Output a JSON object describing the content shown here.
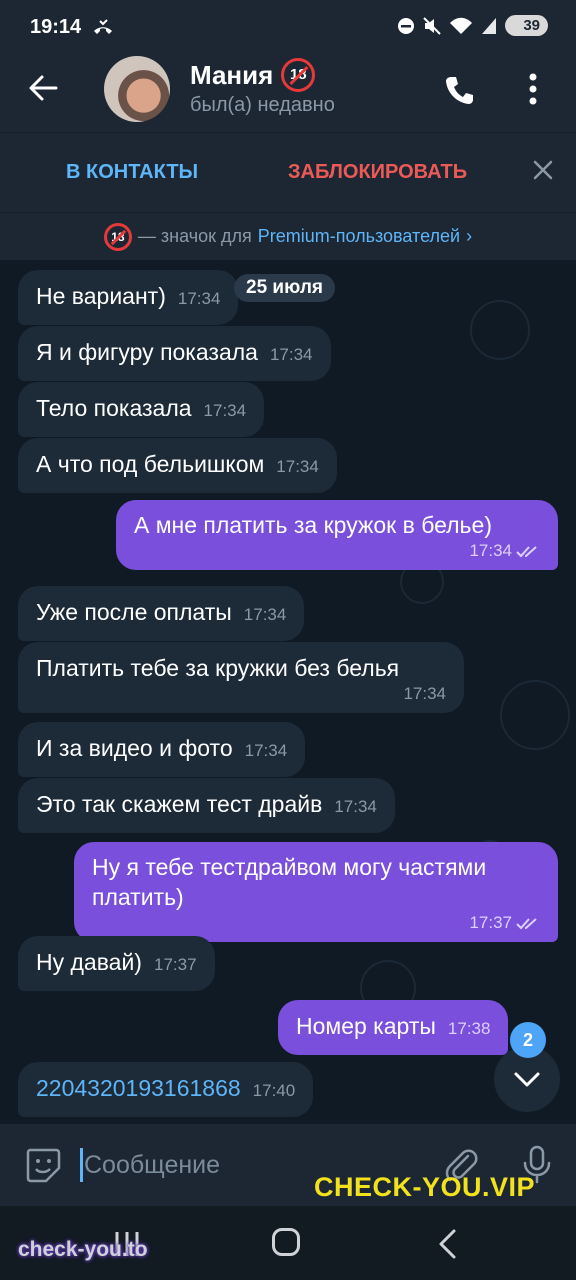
{
  "status_bar": {
    "time": "19:14",
    "battery": "39"
  },
  "header": {
    "contact_name": "Мания",
    "last_seen": "был(а) недавно",
    "avatar_badge": "18"
  },
  "actions": {
    "add_contact": "В КОНТАКТЫ",
    "block": "ЗАБЛОКИРОВАТЬ"
  },
  "premium_notice": {
    "prefix": "— значок для",
    "link": "Premium-пользователей",
    "arrow": "›"
  },
  "date_pill": "25 июля",
  "messages": [
    {
      "dir": "in",
      "text": "Не вариант)",
      "time": "17:34"
    },
    {
      "dir": "in",
      "text": "Я и фигуру показала",
      "time": "17:34"
    },
    {
      "dir": "in",
      "text": "Тело показала",
      "time": "17:34"
    },
    {
      "dir": "in",
      "text": "А что под бельишком",
      "time": "17:34"
    },
    {
      "dir": "out",
      "text": "А мне платить за кружок в белье)",
      "time": "17:34"
    },
    {
      "dir": "in",
      "text": "Уже после оплаты",
      "time": "17:34"
    },
    {
      "dir": "in",
      "text": "Платить тебе за кружки без белья",
      "time": "17:34"
    },
    {
      "dir": "in",
      "text": "И за видео и фото",
      "time": "17:34"
    },
    {
      "dir": "in",
      "text": "Это так скажем тест драйв",
      "time": "17:34"
    },
    {
      "dir": "out",
      "text": "Ну я тебе тестдрайвом могу частями платить)",
      "time": "17:37"
    },
    {
      "dir": "in",
      "text": "Ну давай)",
      "time": "17:37"
    },
    {
      "dir": "out",
      "text": "Номер карты",
      "time": "17:38"
    },
    {
      "dir": "in",
      "text": "2204320193161868",
      "time": "17:40"
    }
  ],
  "unread_count": "2",
  "composer": {
    "placeholder": "Сообщение"
  },
  "watermarks": {
    "bottom_right": "CHECK-YOU.VIP",
    "bottom_left": "check-you.to"
  },
  "colors": {
    "accent": "#5eb5f7",
    "danger": "#ec5a57",
    "outgoing_bubble": "#7a4fdc",
    "incoming_bubble": "#1d2a37",
    "background": "#0e1621"
  },
  "icons": [
    "back-arrow-icon",
    "phone-icon",
    "more-vertical-icon",
    "close-icon",
    "sticker-icon",
    "attach-icon",
    "microphone-icon",
    "scroll-down-icon",
    "double-check-icon",
    "missed-call-icon"
  ]
}
